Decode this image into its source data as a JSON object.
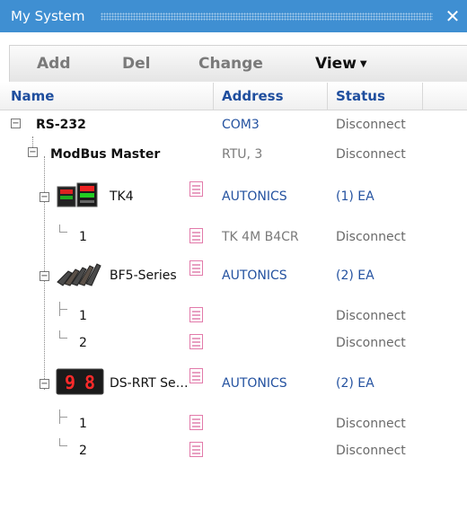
{
  "window": {
    "title": "My System"
  },
  "toolbar": {
    "add": "Add",
    "del": "Del",
    "change": "Change",
    "view": "View"
  },
  "columns": {
    "name": "Name",
    "address": "Address",
    "status": "Status"
  },
  "tree": {
    "rs232": {
      "name": "RS-232",
      "address": "COM3",
      "status": "Disconnect"
    },
    "modbus": {
      "name": "ModBus Master",
      "address": "RTU, 3",
      "status": "Disconnect"
    },
    "tk4": {
      "name": "TK4",
      "address": "AUTONICS",
      "status": "(1) EA",
      "children": [
        {
          "name": "1",
          "address": "TK 4M B4CR",
          "status": "Disconnect"
        }
      ]
    },
    "bf5": {
      "name": "BF5-Series",
      "address": "AUTONICS",
      "status": "(2) EA",
      "children": [
        {
          "name": "1",
          "address": "",
          "status": "Disconnect"
        },
        {
          "name": "2",
          "address": "",
          "status": "Disconnect"
        }
      ]
    },
    "ds": {
      "name": "DS-RRT Se…",
      "address": "AUTONICS",
      "status": "(2) EA",
      "display_digits": "98",
      "children": [
        {
          "name": "1",
          "address": "",
          "status": "Disconnect"
        },
        {
          "name": "2",
          "address": "",
          "status": "Disconnect"
        }
      ]
    }
  },
  "colors": {
    "titlebar": "#3f8fd2",
    "header_text": "#1f4e9e",
    "address_blue": "#2452a0",
    "doc_icon": "#e27aaa"
  }
}
